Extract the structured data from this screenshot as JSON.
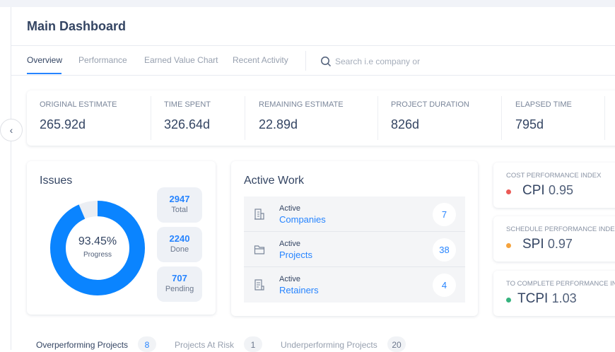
{
  "header": {
    "title": "Main Dashboard"
  },
  "tabs": [
    {
      "label": "Overview"
    },
    {
      "label": "Performance"
    },
    {
      "label": "Earned Value Chart"
    },
    {
      "label": "Recent Activity"
    }
  ],
  "search": {
    "placeholder": "Search i.e company or"
  },
  "stats": [
    {
      "label": "Original Estimate",
      "value": "265.92d"
    },
    {
      "label": "Time Spent",
      "value": "326.64d"
    },
    {
      "label": "Remaining Estimate",
      "value": "22.89d"
    },
    {
      "label": "Project Duration",
      "value": "826d"
    },
    {
      "label": "Elapsed Time",
      "value": "795d"
    }
  ],
  "issues": {
    "title": "Issues",
    "progress_label": "93.45%",
    "progress_caption": "Progress",
    "progress_fraction": 0.9345,
    "pills": [
      {
        "value": "2947",
        "label": "Total"
      },
      {
        "value": "2240",
        "label": "Done"
      },
      {
        "value": "707",
        "label": "Pending"
      }
    ]
  },
  "active_work": {
    "title": "Active Work",
    "rows": [
      {
        "prefix": "Active",
        "label": "Companies",
        "count": "7",
        "icon": "building-icon"
      },
      {
        "prefix": "Active",
        "label": "Projects",
        "count": "38",
        "icon": "folder-icon"
      },
      {
        "prefix": "Active",
        "label": "Retainers",
        "count": "4",
        "icon": "document-icon"
      }
    ]
  },
  "kpis": [
    {
      "label": "COST PERFORMANCE INDEX",
      "name": "CPI",
      "value": "0.95",
      "color": "#eb5a56"
    },
    {
      "label": "SCHEDULE PERFORMANCE INDEX",
      "name": "SPI",
      "value": "0.97",
      "color": "#f5a33d"
    },
    {
      "label": "TO COMPLETE PERFORMANCE INDEX",
      "name": "TCPI",
      "value": "1.03",
      "color": "#36b37e"
    }
  ],
  "bottom_tabs": [
    {
      "label": "Overperforming Projects",
      "count": "8"
    },
    {
      "label": "Projects At Risk",
      "count": "1"
    },
    {
      "label": "Underperforming Projects",
      "count": "20"
    }
  ],
  "colors": {
    "accent": "#2684ff"
  }
}
